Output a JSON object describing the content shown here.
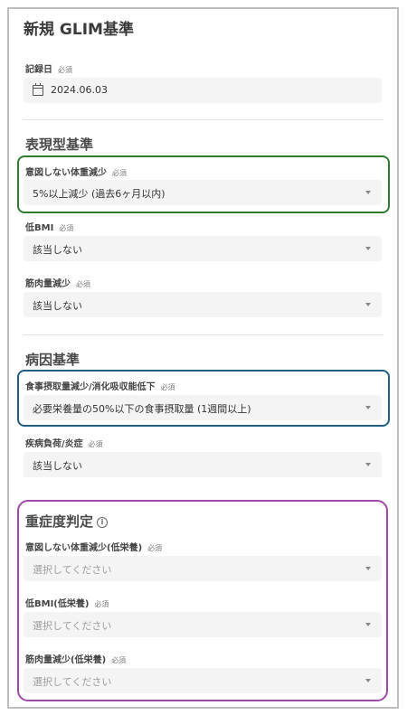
{
  "page": {
    "title": "新規 GLIM基準"
  },
  "required_tag": "必須",
  "record_date": {
    "label": "記録日",
    "value": "2024.06.03"
  },
  "phenotypic": {
    "title": "表現型基準",
    "fields": [
      {
        "label": "意図しない体重減少",
        "value": "5%以上減少 (過去6ヶ月以内)"
      },
      {
        "label": "低BMI",
        "value": "該当しない"
      },
      {
        "label": "筋肉量減少",
        "value": "該当しない"
      }
    ]
  },
  "etiologic": {
    "title": "病因基準",
    "fields": [
      {
        "label": "食事摂取量減少/消化吸収能低下",
        "value": "必要栄養量の50%以下の食事摂取量 (1週間以上)"
      },
      {
        "label": "疾病負荷/炎症",
        "value": "該当しない"
      }
    ]
  },
  "severity": {
    "title": "重症度判定",
    "info_icon": "i",
    "fields": [
      {
        "label": "意図しない体重減少(低栄養)",
        "placeholder": "選択してください"
      },
      {
        "label": "低BMI(低栄養)",
        "placeholder": "選択してください"
      },
      {
        "label": "筋肉量減少(低栄養)",
        "placeholder": "選択してください"
      }
    ]
  },
  "colors": {
    "highlight_green": "#2e7d32",
    "highlight_blue": "#1f5f7f",
    "highlight_purple": "#a04aa8"
  }
}
